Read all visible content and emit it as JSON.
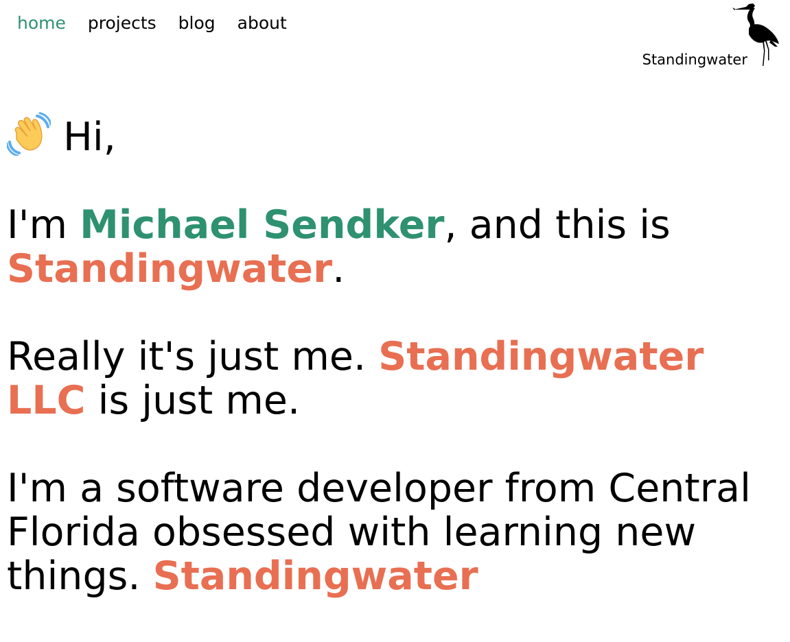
{
  "nav": {
    "items": [
      {
        "label": "home",
        "active": true
      },
      {
        "label": "projects",
        "active": false
      },
      {
        "label": "blog",
        "active": false
      },
      {
        "label": "about",
        "active": false
      }
    ]
  },
  "brand": {
    "name": "Standingwater",
    "logo_icon": "heron-icon"
  },
  "hero": {
    "greeting_icon": "waving-hand-icon",
    "greeting": "Hi,",
    "intro_prefix": "I'm ",
    "intro_name": "Michael Sendker",
    "intro_middle": ", and this is ",
    "intro_brand": "Standingwater",
    "intro_suffix": ".",
    "line2_prefix": "Really it's just me. ",
    "line2_brand": "Standingwater LLC",
    "line2_suffix": " is just me.",
    "line3_text": "I'm a software developer from Central Florida obsessed with learning new things. ",
    "line3_brand": "Standingwater"
  },
  "colors": {
    "accent_green": "#2e9170",
    "accent_orange": "#e86f52",
    "wave_yellow": "#fdcb58",
    "wave_blue": "#5dadec"
  }
}
